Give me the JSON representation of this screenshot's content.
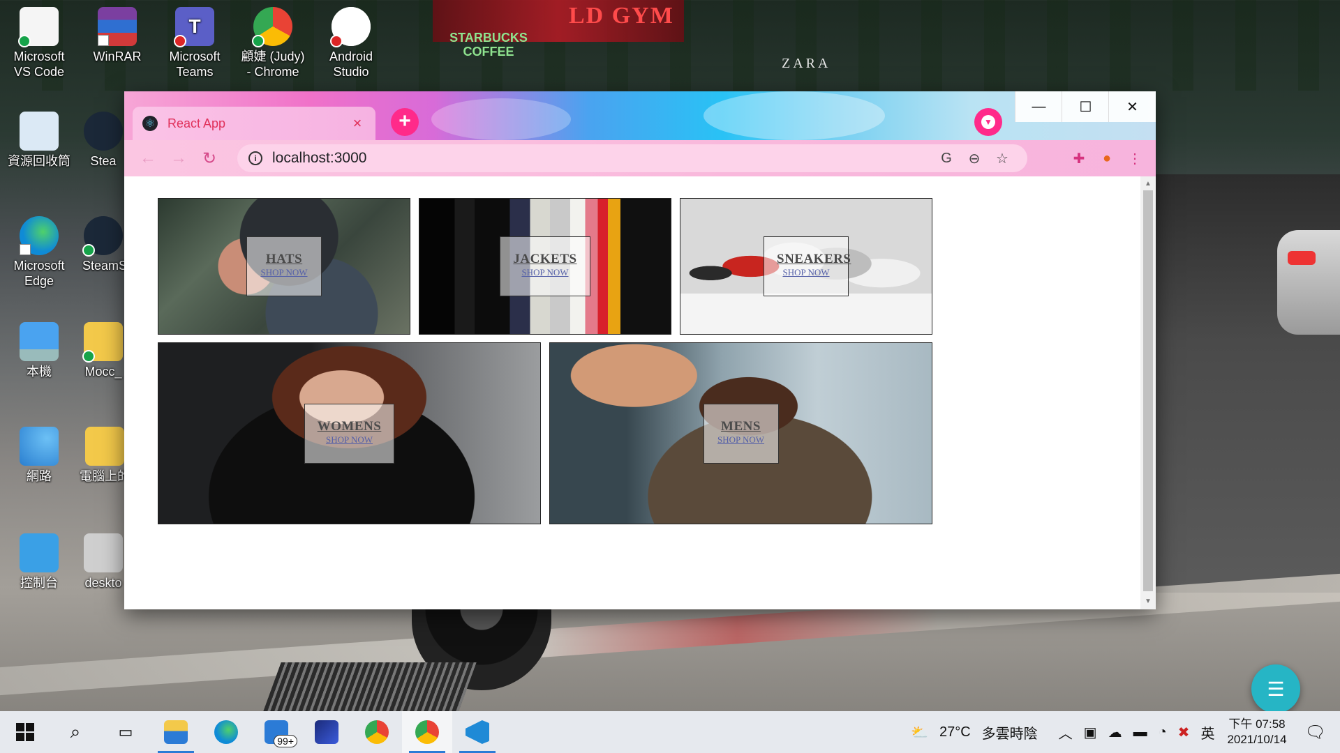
{
  "desktop": {
    "wallpaper_signs": {
      "gym": "LD GYM",
      "starbucks": "STARBUCKS COFFEE",
      "zara": "ZARA"
    },
    "icons": [
      {
        "label": "Microsoft VS Code",
        "color": "#f5f5f5",
        "badge": "ok"
      },
      {
        "label": "WinRAR",
        "color": "#7b3fa0",
        "badge": "none"
      },
      {
        "label": "Microsoft Teams",
        "color": "#5b5fc7",
        "badge": "err"
      },
      {
        "label": "顧婕 (Judy) - Chrome",
        "color": "#e94335",
        "badge": "ok"
      },
      {
        "label": "Android Studio",
        "color": "#3ddc84",
        "badge": "err"
      },
      {
        "label": "資源回收筒",
        "color": "#dbe9f5",
        "badge": "none"
      },
      {
        "label": "Stea",
        "color": "#1b2838",
        "badge": "none"
      },
      {
        "label": "Microsoft Edge",
        "color": "#0f8bd6",
        "badge": "link"
      },
      {
        "label": "SteamS",
        "color": "#1b2838",
        "badge": "ok"
      },
      {
        "label": "本機",
        "color": "#4aa3f0",
        "badge": "none"
      },
      {
        "label": "Mocc_",
        "color": "#f3c94a",
        "badge": "ok"
      },
      {
        "label": "網路",
        "color": "#3aa0e6",
        "badge": "none"
      },
      {
        "label": "電腦上的",
        "color": "#f3c94a",
        "badge": "none"
      },
      {
        "label": "控制台",
        "color": "#3aa0e6",
        "badge": "none"
      },
      {
        "label": "deskto",
        "color": "#cfcfcf",
        "badge": "none"
      }
    ]
  },
  "browser": {
    "tab": {
      "title": "React App",
      "favicon": "react-icon",
      "close": "×"
    },
    "new_tab": "+",
    "window_controls": {
      "minimize": "—",
      "maximize": "☐",
      "close": "✕"
    },
    "nav": {
      "back": "←",
      "forward": "→",
      "reload": "↻"
    },
    "omnibox": {
      "info": "i",
      "url": "localhost:3000"
    },
    "omnibox_actions": {
      "translate": "G",
      "zoom": "⊖",
      "bookmark": "☆"
    },
    "toolbar_actions": {
      "extensions": "✚",
      "profile": "●",
      "menu": "⋮"
    }
  },
  "page": {
    "categories": [
      {
        "title": "HATS",
        "cta": "SHOP NOW"
      },
      {
        "title": "JACKETS",
        "cta": "SHOP NOW"
      },
      {
        "title": "SNEAKERS",
        "cta": "SHOP NOW"
      },
      {
        "title": "WOMENS",
        "cta": "SHOP NOW"
      },
      {
        "title": "MENS",
        "cta": "SHOP NOW"
      }
    ]
  },
  "taskbar": {
    "apps": [
      "start",
      "search",
      "task-view",
      "file-explorer",
      "edge",
      "mail",
      "app-alpha",
      "chrome",
      "chrome-profile",
      "vscode"
    ],
    "mail_badge": "99+",
    "weather": {
      "temp": "27°C",
      "desc": "多雲時陰"
    },
    "ime": "英",
    "clock": {
      "time": "下午 07:58",
      "date": "2021/10/14"
    }
  },
  "colors": {
    "accent": "#ff2a8a",
    "tab_text": "#e0305a",
    "taskbar": "#e6e9ee"
  }
}
